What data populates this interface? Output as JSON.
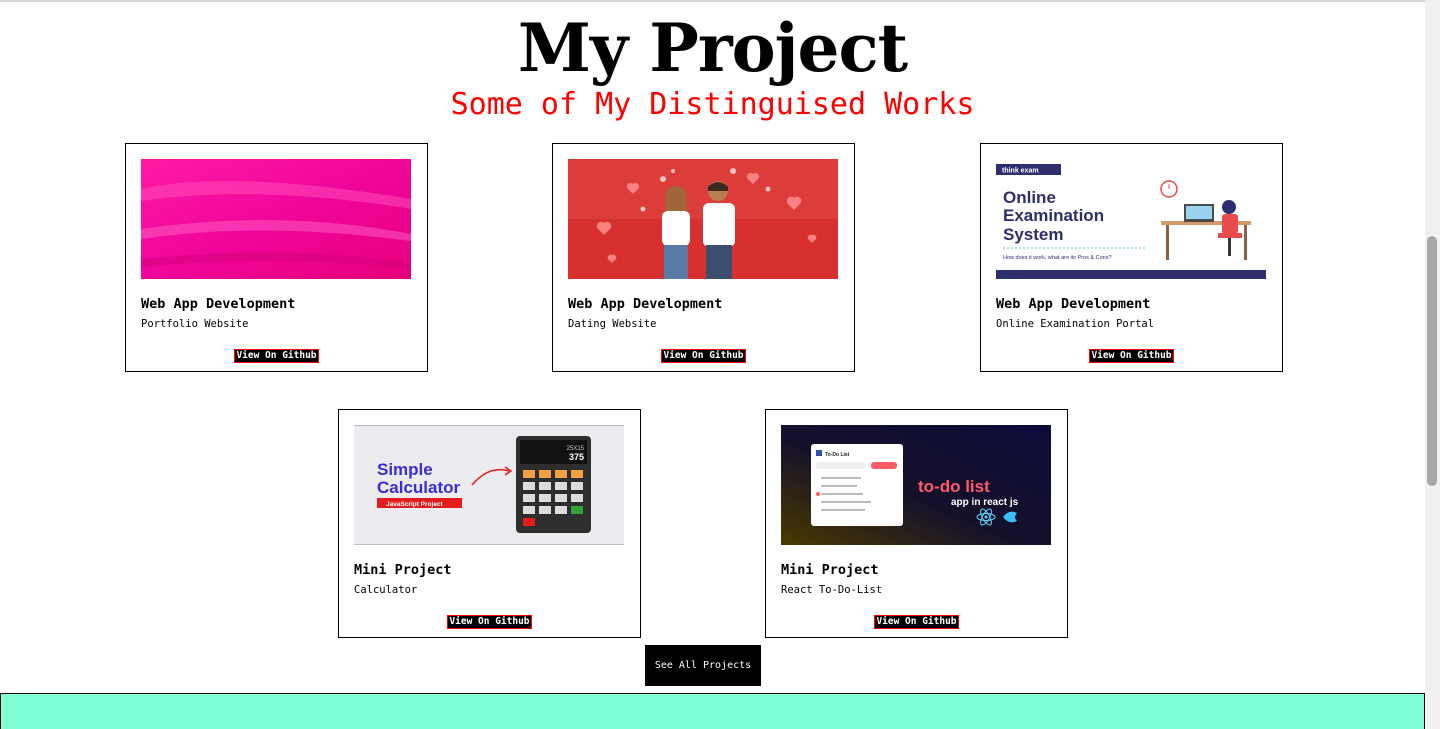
{
  "header": {
    "title": "My Project",
    "subtitle": "Some of My Distinguised Works"
  },
  "projects": [
    {
      "category": "Web App Development",
      "description": "Portfolio Website",
      "button": "View On Github",
      "image": "pink-gradient-thumbnail"
    },
    {
      "category": "Web App Development",
      "description": "Dating Website",
      "button": "View On Github",
      "image": "couple-hearts-thumbnail"
    },
    {
      "category": "Web App Development",
      "description": "Online Examination Portal",
      "button": "View On Github",
      "image": "online-exam-thumbnail",
      "image_text": {
        "badge": "think exam",
        "line1": "Online",
        "line2": "Examination",
        "line3": "System",
        "tagline": "How does it work, what are its Pros & Cons?"
      }
    },
    {
      "category": "Mini Project",
      "description": "Calculator",
      "button": "View On Github",
      "image": "calculator-thumbnail",
      "image_text": {
        "line1": "Simple",
        "line2": "Calculator",
        "tag": "JavaScript Project",
        "expr": "25X15",
        "result": "375"
      }
    },
    {
      "category": "Mini Project",
      "description": "React To-Do-List",
      "button": "View On Github",
      "image": "todo-list-thumbnail",
      "image_text": {
        "app_title": "To-Do List",
        "line1": "to-do list",
        "line2": "app in react js"
      }
    }
  ],
  "see_all_label": "See All Projects",
  "colors": {
    "accent": "#ff0000",
    "footer": "#7fffd4",
    "button_bg": "#000000"
  }
}
